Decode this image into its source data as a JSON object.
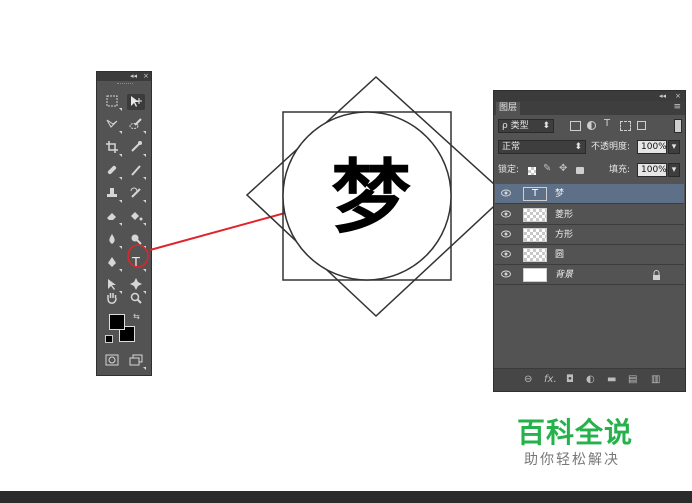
{
  "tools_panel": {
    "header_collapse": "◂◂",
    "header_close": "×",
    "type_tool_glyph": "T"
  },
  "artwork": {
    "glyph_text": "梦"
  },
  "layers_panel": {
    "header_collapse": "◂◂",
    "header_close": "×",
    "menu_icon": "≡",
    "tab_label": "图层",
    "filter_label": "ρ 类型",
    "blend_mode": "正常",
    "opacity_label": "不透明度:",
    "opacity_value": "100%",
    "lock_label": "锁定:",
    "fill_label": "填充:",
    "fill_value": "100%",
    "layers": [
      {
        "name": "梦",
        "type": "text",
        "selected": true
      },
      {
        "name": "菱形",
        "type": "shape",
        "selected": false
      },
      {
        "name": "方形",
        "type": "shape",
        "selected": false
      },
      {
        "name": "圆",
        "type": "shape",
        "selected": false
      },
      {
        "name": "背景",
        "type": "background",
        "selected": false,
        "locked": true
      }
    ],
    "footer_fx": "fx."
  },
  "watermark": {
    "title": "百科全说",
    "subtitle": "助你轻松解决"
  },
  "colors": {
    "panel_bg": "#535353",
    "selected_layer": "#5e6f88",
    "arrow": "#e0242b",
    "watermark_green": "#26b24b"
  }
}
